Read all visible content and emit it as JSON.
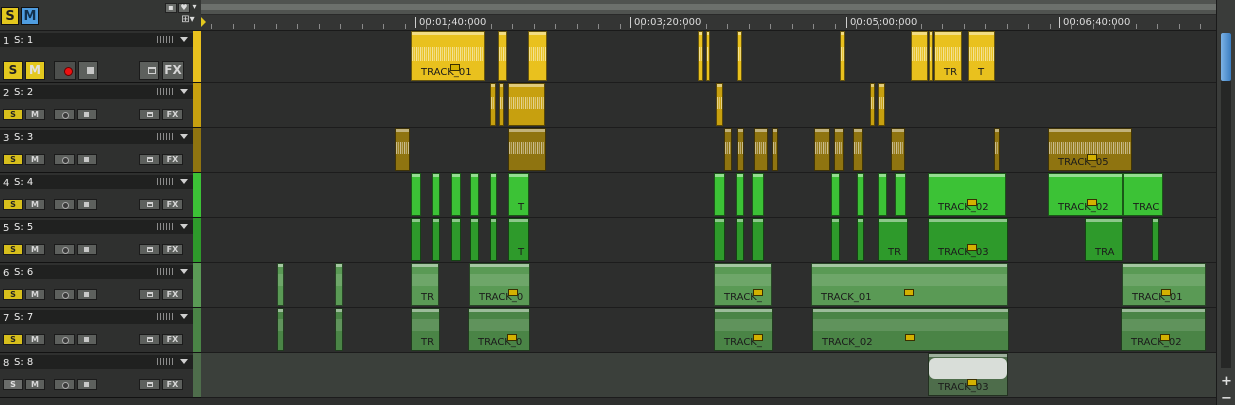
{
  "header": {
    "solo_all_label": "S",
    "mute_all_label": "M",
    "lock_icon": "lock-icon",
    "heart_icon": "heart-icon",
    "dropdown_icon": "chevron-down-icon",
    "grid_icon": "grid-icon"
  },
  "ruler": {
    "timecodes": [
      "00:01:40:000",
      "00:03:20:000",
      "00:05:00:000",
      "00:06:40:000"
    ]
  },
  "buttons": {
    "solo": "S",
    "mute": "M",
    "fx": "FX"
  },
  "tracks": [
    {
      "number": "1",
      "name": "S: 1",
      "color": "#e9c11e"
    },
    {
      "number": "2",
      "name": "S: 2",
      "color": "#c7a00f"
    },
    {
      "number": "3",
      "name": "S: 3",
      "color": "#8f7410"
    },
    {
      "number": "4",
      "name": "S: 4",
      "color": "#3cc236"
    },
    {
      "number": "5",
      "name": "S: 5",
      "color": "#2e9a2b"
    },
    {
      "number": "6",
      "name": "S: 6",
      "color": "#5a9a55"
    },
    {
      "number": "7",
      "name": "S: 7",
      "color": "#4a8446"
    },
    {
      "number": "8",
      "name": "S: 8",
      "color": "#4e6d4b"
    }
  ],
  "clips": [
    {
      "track": 0,
      "label": "TRACK_01"
    },
    {
      "track": 0,
      "label": "TR"
    },
    {
      "track": 0,
      "label": "T"
    },
    {
      "track": 2,
      "label": "TRACK_05"
    },
    {
      "track": 3,
      "label": "T"
    },
    {
      "track": 3,
      "label": "TRACK_02"
    },
    {
      "track": 3,
      "label": "TRACK_02"
    },
    {
      "track": 3,
      "label": "TRAC"
    },
    {
      "track": 4,
      "label": "T"
    },
    {
      "track": 4,
      "label": "TR"
    },
    {
      "track": 4,
      "label": "TRACK_03"
    },
    {
      "track": 4,
      "label": "TRA"
    },
    {
      "track": 5,
      "label": "TR"
    },
    {
      "track": 5,
      "label": "TRACK_0"
    },
    {
      "track": 5,
      "label": "TRACK_"
    },
    {
      "track": 5,
      "label": "TRACK_01"
    },
    {
      "track": 5,
      "label": "TRACK_01"
    },
    {
      "track": 6,
      "label": "TR"
    },
    {
      "track": 6,
      "label": "TRACK_0"
    },
    {
      "track": 6,
      "label": "TRACK_"
    },
    {
      "track": 6,
      "label": "TRACK_02"
    },
    {
      "track": 6,
      "label": "TRACK_02"
    },
    {
      "track": 7,
      "label": "TRACK_03"
    }
  ],
  "scrollbar": {
    "zoom_in": "+",
    "zoom_out": "−"
  }
}
